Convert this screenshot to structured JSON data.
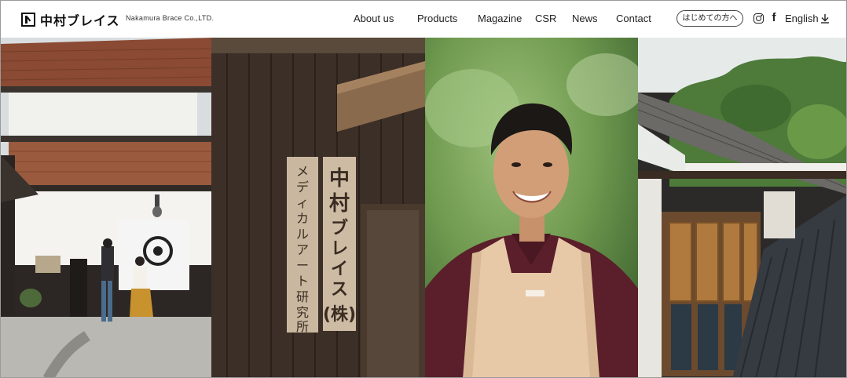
{
  "header": {
    "logo_jp": "中村ブレイス",
    "logo_en": "Nakamura Brace Co.,LTD.",
    "nav": [
      "About us",
      "Products",
      "Magazine",
      "CSR",
      "News",
      "Contact"
    ],
    "beginner_button": "はじめての方へ",
    "social": [
      "instagram-icon",
      "facebook-icon"
    ],
    "language": "English"
  },
  "hero": {
    "panels": [
      "village-street-photo",
      "wooden-signboard-photo",
      "craftsman-portrait-photo",
      "traditional-building-photo"
    ],
    "signboard_text": [
      "中村ブレイス(株)",
      "メディカルアート研究所"
    ]
  },
  "colors": {
    "text": "#222222",
    "background": "#ffffff",
    "border": "#9a9a9a"
  }
}
